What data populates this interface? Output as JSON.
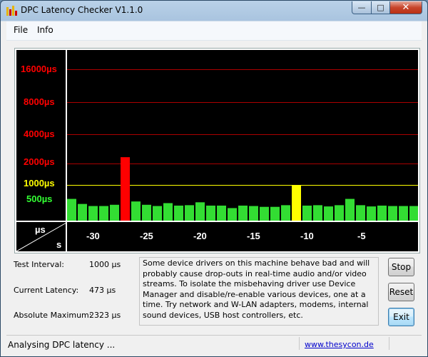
{
  "window": {
    "title": "DPC Latency Checker V1.1.0",
    "min_glyph": "—",
    "max_glyph": "□",
    "close_glyph": "✕"
  },
  "menu": {
    "items": [
      "File",
      "Info"
    ]
  },
  "chart": {
    "y_labels": [
      {
        "text": "16000µs",
        "color": "#ff0000"
      },
      {
        "text": "8000µs",
        "color": "#ff0000"
      },
      {
        "text": "4000µs",
        "color": "#ff0000"
      },
      {
        "text": "2000µs",
        "color": "#ff0000"
      },
      {
        "text": "1000µs",
        "color": "#ffff00"
      },
      {
        "text": "500µs",
        "color": "#33ff33"
      }
    ],
    "corner": {
      "top": "µs",
      "bottom": "s"
    },
    "x_ticks": [
      "-30",
      "-25",
      "-20",
      "-15",
      "-10",
      "-5"
    ],
    "colors": {
      "grid_red": "#aa0000",
      "grid_yellow": "#ffff00",
      "green": "#33dd33",
      "red": "#ff0000",
      "yellow": "#ffff00"
    }
  },
  "chart_data": {
    "type": "bar",
    "title": "",
    "xlabel": "s",
    "ylabel": "µs",
    "x_range": [
      -33,
      -0.5
    ],
    "x_tick_labels": [
      "-30",
      "-25",
      "-20",
      "-15",
      "-10",
      "-5"
    ],
    "y_tick_labels": [
      "500µs",
      "1000µs",
      "2000µs",
      "4000µs",
      "8000µs",
      "16000µs"
    ],
    "y_scale": "log",
    "values": [
      540,
      420,
      370,
      370,
      400,
      2323,
      480,
      400,
      370,
      440,
      380,
      390,
      460,
      380,
      380,
      320,
      380,
      370,
      350,
      350,
      390,
      1000,
      380,
      390,
      360,
      390,
      540,
      390,
      360,
      380,
      370,
      370,
      370
    ],
    "bar_colors": [
      "green",
      "green",
      "green",
      "green",
      "green",
      "red",
      "green",
      "green",
      "green",
      "green",
      "green",
      "green",
      "green",
      "green",
      "green",
      "green",
      "green",
      "green",
      "green",
      "green",
      "green",
      "yellow",
      "green",
      "green",
      "green",
      "green",
      "green",
      "green",
      "green",
      "green",
      "green",
      "green",
      "green"
    ]
  },
  "info": {
    "test_interval_label": "Test Interval:",
    "test_interval_value": "1000 µs",
    "current_latency_label": "Current Latency:",
    "current_latency_value": "473 µs",
    "absolute_maximum_label": "Absolute Maximum:",
    "absolute_maximum_value": "2323 µs"
  },
  "message": "Some device drivers on this machine behave bad and will probably cause drop-outs in real-time audio and/or video streams. To isolate the misbehaving driver use Device Manager and disable/re-enable various devices, one at a time. Try network and W-LAN adapters, modems, internal sound devices, USB host controllers, etc.",
  "buttons": {
    "stop": "Stop",
    "reset": "Reset",
    "exit": "Exit"
  },
  "status": {
    "text": "Analysing DPC latency ...",
    "link": "www.thesycon.de"
  }
}
